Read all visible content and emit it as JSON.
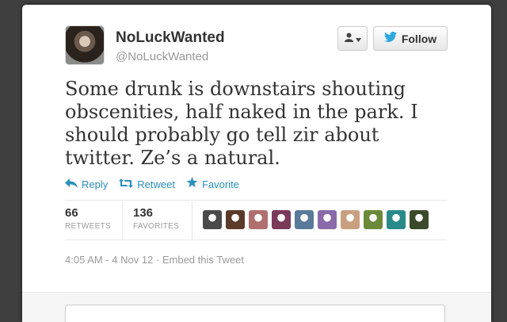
{
  "user": {
    "display_name": "NoLuckWanted",
    "handle": "@NoLuckWanted"
  },
  "header_buttons": {
    "user_dropdown_icon": "person-icon",
    "follow_label": "Follow"
  },
  "tweet": {
    "text": "Some drunk is downstairs shouting obscenities, half naked in the park. I should probably go tell zir about twitter. Ze’s a natural."
  },
  "actions": {
    "reply": "Reply",
    "retweet": "Retweet",
    "favorite": "Favorite"
  },
  "stats": {
    "retweets_count": "66",
    "retweets_label": "RETWEETS",
    "favorites_count": "136",
    "favorites_label": "FAVORITES"
  },
  "faces": [
    {
      "color": "#4a4a4a"
    },
    {
      "color": "#5b3a2a"
    },
    {
      "color": "#b07070"
    },
    {
      "color": "#7a3a5a"
    },
    {
      "color": "#5a7a9a"
    },
    {
      "color": "#8a6aa8"
    },
    {
      "color": "#c8a080"
    },
    {
      "color": "#6a8a3a"
    },
    {
      "color": "#2a8a8a"
    },
    {
      "color": "#3a4a2a"
    }
  ],
  "meta": {
    "timestamp": "4:05 AM - 4 Nov 12",
    "separator": " · ",
    "embed": "Embed this Tweet"
  },
  "colors": {
    "link": "#2a8fbd",
    "twitter_bird": "#2fa8e0"
  }
}
